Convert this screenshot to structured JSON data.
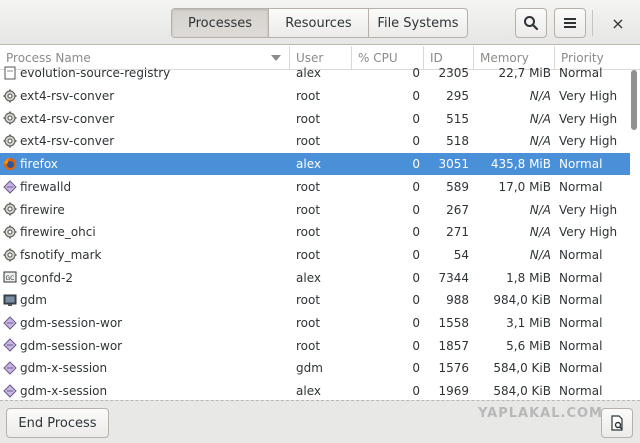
{
  "header": {
    "tabs": [
      {
        "label": "Processes",
        "active": true
      },
      {
        "label": "Resources",
        "active": false
      },
      {
        "label": "File Systems",
        "active": false
      }
    ],
    "search_icon": "search-icon",
    "menu_icon": "hamburger-menu-icon",
    "close_label": "×"
  },
  "columns": [
    "Process Name",
    "User",
    "% CPU",
    "ID",
    "Memory",
    "Priority"
  ],
  "rows": [
    {
      "icon": "document",
      "name": "evolution-source-registry",
      "user": "alex",
      "cpu": "0",
      "id": "2305",
      "memory": "22,7 MiB",
      "priority": "Normal",
      "selected": false
    },
    {
      "icon": "gear",
      "name": "ext4-rsv-conver",
      "user": "root",
      "cpu": "0",
      "id": "295",
      "memory": "N/A",
      "priority": "Very High",
      "selected": false
    },
    {
      "icon": "gear",
      "name": "ext4-rsv-conver",
      "user": "root",
      "cpu": "0",
      "id": "515",
      "memory": "N/A",
      "priority": "Very High",
      "selected": false
    },
    {
      "icon": "gear",
      "name": "ext4-rsv-conver",
      "user": "root",
      "cpu": "0",
      "id": "518",
      "memory": "N/A",
      "priority": "Very High",
      "selected": false
    },
    {
      "icon": "firefox",
      "name": "firefox",
      "user": "alex",
      "cpu": "0",
      "id": "3051",
      "memory": "435,8 MiB",
      "priority": "Normal",
      "selected": true
    },
    {
      "icon": "diamond",
      "name": "firewalld",
      "user": "root",
      "cpu": "0",
      "id": "589",
      "memory": "17,0 MiB",
      "priority": "Normal",
      "selected": false
    },
    {
      "icon": "gear",
      "name": "firewire",
      "user": "root",
      "cpu": "0",
      "id": "267",
      "memory": "N/A",
      "priority": "Very High",
      "selected": false
    },
    {
      "icon": "gear",
      "name": "firewire_ohci",
      "user": "root",
      "cpu": "0",
      "id": "271",
      "memory": "N/A",
      "priority": "Very High",
      "selected": false
    },
    {
      "icon": "gear",
      "name": "fsnotify_mark",
      "user": "root",
      "cpu": "0",
      "id": "54",
      "memory": "N/A",
      "priority": "Normal",
      "selected": false
    },
    {
      "icon": "gconf",
      "name": "gconfd-2",
      "user": "alex",
      "cpu": "0",
      "id": "7344",
      "memory": "1,8 MiB",
      "priority": "Normal",
      "selected": false
    },
    {
      "icon": "monitor",
      "name": "gdm",
      "user": "root",
      "cpu": "0",
      "id": "988",
      "memory": "984,0 KiB",
      "priority": "Normal",
      "selected": false
    },
    {
      "icon": "diamond",
      "name": "gdm-session-wor",
      "user": "root",
      "cpu": "0",
      "id": "1558",
      "memory": "3,1 MiB",
      "priority": "Normal",
      "selected": false
    },
    {
      "icon": "diamond",
      "name": "gdm-session-wor",
      "user": "root",
      "cpu": "0",
      "id": "1857",
      "memory": "5,6 MiB",
      "priority": "Normal",
      "selected": false
    },
    {
      "icon": "diamond",
      "name": "gdm-x-session",
      "user": "gdm",
      "cpu": "0",
      "id": "1576",
      "memory": "584,0 KiB",
      "priority": "Normal",
      "selected": false
    },
    {
      "icon": "diamond",
      "name": "gdm-x-session",
      "user": "alex",
      "cpu": "0",
      "id": "1969",
      "memory": "584,0 KiB",
      "priority": "Normal",
      "selected": false
    }
  ],
  "footer": {
    "end_process_label": "End Process",
    "watermark": "YAPLAKAL.COM",
    "properties_icon": "properties-icon"
  },
  "colors": {
    "selection": "#4a90d9",
    "header_text": "#8a8c88"
  }
}
